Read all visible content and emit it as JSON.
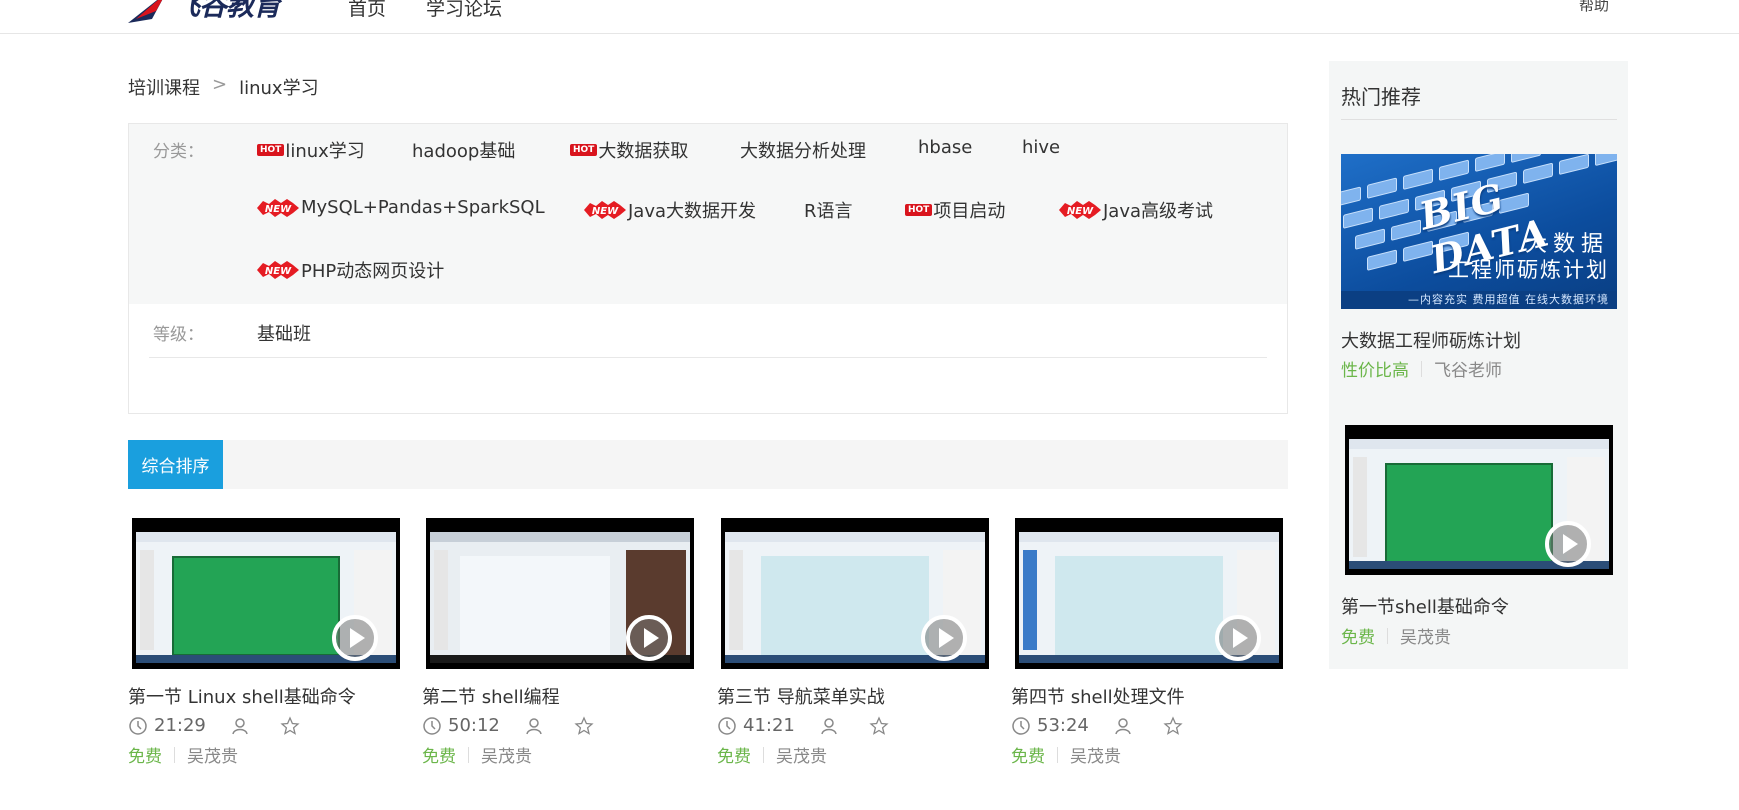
{
  "header": {
    "logo_text": "飞谷教育",
    "nav": [
      "首页",
      "学习论坛"
    ],
    "help": "帮助"
  },
  "breadcrumb": {
    "root": "培训课程",
    "sep": ">",
    "current": "linux学习"
  },
  "filter": {
    "category_label": "分类：",
    "level_label": "等级：",
    "level_value": "基础班",
    "tags": [
      {
        "label": "linux学习",
        "badge": "hot"
      },
      {
        "label": "hadoop基础",
        "badge": ""
      },
      {
        "label": "大数据获取",
        "badge": "hot"
      },
      {
        "label": "大数据分析处理",
        "badge": ""
      },
      {
        "label": "hbase",
        "badge": ""
      },
      {
        "label": "hive",
        "badge": ""
      },
      {
        "label": "MySQL+Pandas+SparkSQL",
        "badge": "new"
      },
      {
        "label": "Java大数据开发",
        "badge": "new"
      },
      {
        "label": "R语言",
        "badge": ""
      },
      {
        "label": "项目启动",
        "badge": "hot"
      },
      {
        "label": "Java高级考试",
        "badge": "new"
      },
      {
        "label": "PHP动态网页设计",
        "badge": "new"
      }
    ],
    "badge_hot_text": "HOT",
    "badge_new_text": "NEW"
  },
  "sort": {
    "active_label": "综合排序"
  },
  "courses": [
    {
      "title": "第一节 Linux shell基础命令",
      "duration": "21:29",
      "price": "免费",
      "teacher": "吴茂贵"
    },
    {
      "title": "第二节 shell编程",
      "duration": "50:12",
      "price": "免费",
      "teacher": "吴茂贵"
    },
    {
      "title": "第三节 导航菜单实战",
      "duration": "41:21",
      "price": "免费",
      "teacher": "吴茂贵"
    },
    {
      "title": "第四节 shell处理文件",
      "duration": "53:24",
      "price": "免费",
      "teacher": "吴茂贵"
    }
  ],
  "sidebar": {
    "title": "热门推荐",
    "banner": {
      "en": "BIG DATA",
      "cn1": "大数据",
      "cn2": "工程师砺炼计划",
      "cn3": "—内容充实  费用超值  在线大数据环境"
    },
    "items": [
      {
        "title": "大数据工程师砺炼计划",
        "price": "性价比高",
        "teacher": "飞谷老师"
      },
      {
        "title": "第一节shell基础命令",
        "price": "免费",
        "teacher": "吴茂贵"
      }
    ]
  },
  "colors": {
    "accent": "#1a9fde",
    "free_green": "#6bb64a",
    "hot_red": "#d9141d"
  }
}
